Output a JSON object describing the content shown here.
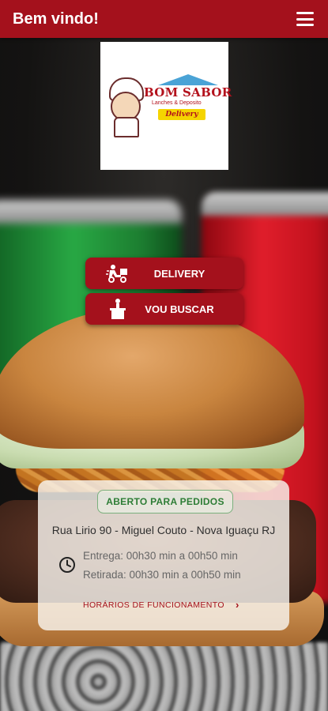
{
  "header": {
    "title": "Bem vindo!",
    "menu_icon": "hamburger-menu-icon"
  },
  "logo": {
    "name": "BOM SABOR",
    "subtitle": "Lanches & Deposito",
    "tag": "Delivery"
  },
  "actions": [
    {
      "label": "DELIVERY",
      "icon": "delivery-scooter-icon"
    },
    {
      "label": "VOU BUSCAR",
      "icon": "pickup-box-icon"
    }
  ],
  "info": {
    "status": "ABERTO PARA PEDIDOS",
    "address": "Rua Lirio 90 - Miguel Couto - Nova Iguaçu RJ",
    "delivery_time": "Entrega: 00h30 min a 00h50 min",
    "pickup_time": "Retirada: 00h30 min a 00h50 min",
    "hours_link": "HORÁRIOS DE FUNCIONAMENTO",
    "clock_icon": "clock-icon"
  },
  "colors": {
    "primary": "#a4111c",
    "status_green": "#2d7d35"
  }
}
